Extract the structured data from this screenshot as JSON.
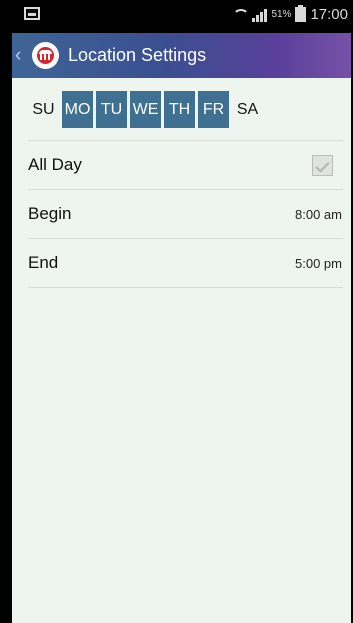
{
  "status": {
    "battery_percent": "51%",
    "time": "17:00",
    "icons": [
      "screenshot-icon",
      "wifi-icon",
      "signal-icon",
      "battery-icon"
    ]
  },
  "app_bar": {
    "title": "Location Settings",
    "back_icon": "chevron-left-icon",
    "logo_icon": "building-logo-icon"
  },
  "days": [
    {
      "label": "SU",
      "selected": false
    },
    {
      "label": "MO",
      "selected": true
    },
    {
      "label": "TU",
      "selected": true
    },
    {
      "label": "WE",
      "selected": true
    },
    {
      "label": "TH",
      "selected": true
    },
    {
      "label": "FR",
      "selected": true
    },
    {
      "label": "SA",
      "selected": false
    }
  ],
  "settings": {
    "all_day": {
      "label": "All Day",
      "checked": true
    },
    "begin": {
      "label": "Begin",
      "value": "8:00 am"
    },
    "end": {
      "label": "End",
      "value": "5:00 pm"
    }
  },
  "colors": {
    "selected_day": "#3f6f91",
    "background": "#eef5ef",
    "app_bar_start": "#3e6595",
    "app_bar_end": "#7751a8"
  }
}
